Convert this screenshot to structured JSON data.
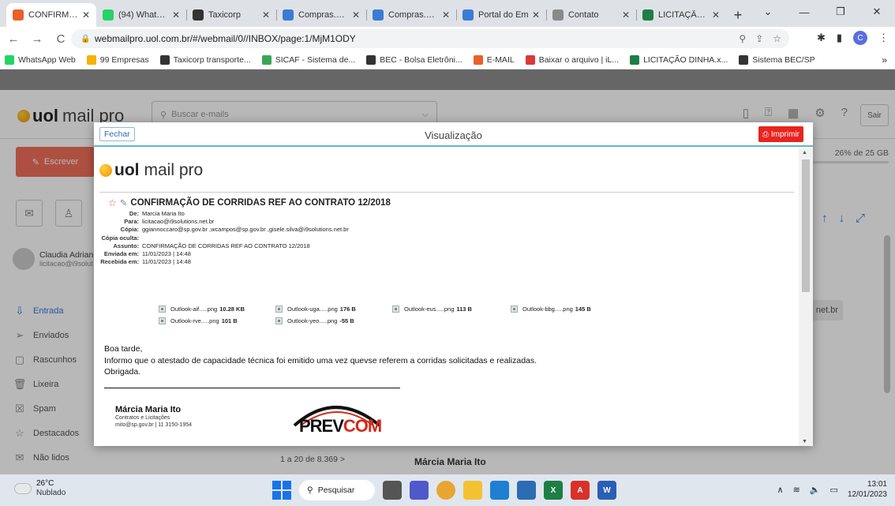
{
  "browser": {
    "tabs": [
      {
        "title": "CONFIRMAÇ",
        "color": "#e8602c",
        "active": true
      },
      {
        "title": "(94) WhatsAp",
        "color": "#25d366"
      },
      {
        "title": "Taxicorp",
        "color": "#333333"
      },
      {
        "title": "Compras.gov",
        "color": "#3a7bd5"
      },
      {
        "title": "Compras.gov",
        "color": "#3a7bd5"
      },
      {
        "title": "Portal do Em",
        "color": "#3a7bd5"
      },
      {
        "title": "Contato",
        "color": "#8a8a8a"
      },
      {
        "title": "LICITAÇÃO DI",
        "color": "#1e7e45"
      }
    ],
    "url": "webmailpro.uol.com.br/#/webmail/0//INBOX/page:1/MjM1ODY",
    "profile_letter": "C",
    "bookmarks": [
      {
        "label": "WhatsApp Web",
        "color": "#25d366"
      },
      {
        "label": "99 Empresas",
        "color": "#f2b400"
      },
      {
        "label": "Taxicorp transporte...",
        "color": "#333333"
      },
      {
        "label": "SICAF - Sistema de...",
        "color": "#3aa655"
      },
      {
        "label": "BEC - Bolsa Eletrôni...",
        "color": "#333333"
      },
      {
        "label": "E-MAIL",
        "color": "#e8602c"
      },
      {
        "label": "Baixar o arquivo | iL...",
        "color": "#d93a3a"
      },
      {
        "label": "LICITAÇÃO DINHA.x...",
        "color": "#1e7e45"
      },
      {
        "label": "Sistema BEC/SP",
        "color": "#333333"
      }
    ]
  },
  "webmail": {
    "brand_bold": "uol",
    "brand_rest": "mail pro",
    "search_placeholder": "Buscar e-mails",
    "logout": "Sair",
    "quota": "26% de 25 GB",
    "compose": "Escrever",
    "user_name": "Claudia Adrian",
    "user_email": "licitacao@i9solut",
    "folders": [
      "Entrada",
      "Enviados",
      "Rascunhos",
      "Lixeira",
      "Spam",
      "Destacados",
      "Não lidos"
    ],
    "paging": "1 a 20 de 8.369 >",
    "behind_sender": "Márcia Maria Ito",
    "behind_domain": "net.br"
  },
  "modal": {
    "close": "Fechar",
    "title": "Visualização",
    "print": "Imprimir",
    "subject": "CONFIRMAÇÃO DE CORRIDAS REF AO CONTRATO 12/2018",
    "meta": [
      {
        "k": "De:",
        "v": "Marcia Maria Ito"
      },
      {
        "k": "Para:",
        "v": "licitacao@i9solutions.net.br"
      },
      {
        "k": "Cópia:",
        "v": "ggiannoccaro@sp.gov.br ,wcampos@sp.gov.br ,gisele.silva@i9solutions.net.br"
      },
      {
        "k": "Cópia oculta:",
        "v": ""
      },
      {
        "k": "Assunto:",
        "v": "CONFIRMAÇÃO DE CORRIDAS REF AO CONTRATO 12/2018"
      },
      {
        "k": "Enviada em:",
        "v": "11/01/2023 | 14:48"
      },
      {
        "k": "Recebida em:",
        "v": "11/01/2023 | 14:48"
      }
    ],
    "attachments": [
      {
        "name": "Outlook-aif.....png",
        "size": "10.28 KB"
      },
      {
        "name": "Outlook-uga.....png",
        "size": "176 B"
      },
      {
        "name": "Outlook-eus.....png",
        "size": "113 B"
      },
      {
        "name": "Outlook-bbg.....png",
        "size": "145 B"
      },
      {
        "name": "Outlook-rve.....png",
        "size": "101 B"
      },
      {
        "name": "Outlook-yeo.....png",
        "size": "-55 B"
      }
    ],
    "body": {
      "greeting": "Boa tarde,",
      "line1": "Informo que o atestado de capacidade técnica foi emitido uma vez quevse  referem a corridas solicitadas e realizadas.",
      "line2": "Obrigada."
    },
    "signature": {
      "name": "Márcia Maria Ito",
      "role": "Contratos e Licitações",
      "contact": "mito@sp.gov.br | 11 3150-1954",
      "logo_a": "PREV",
      "logo_b": "COM"
    }
  },
  "taskbar": {
    "temp": "26°C",
    "weather": "Nublado",
    "search": "Pesquisar",
    "time": "13:01",
    "date": "12/01/2023"
  }
}
